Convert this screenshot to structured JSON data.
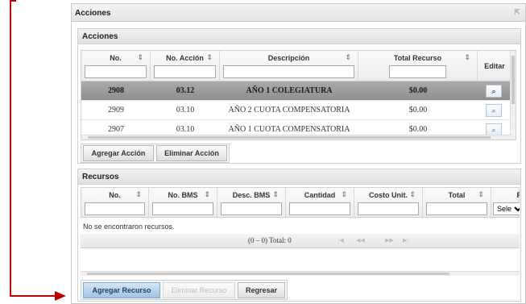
{
  "outer": {
    "title": "Acciones",
    "toggle_glyph": "⇱"
  },
  "acciones": {
    "title": "Acciones",
    "columns": [
      "No.",
      "No. Acción",
      "Descripción",
      "Total Recurso",
      "Editar"
    ],
    "sort_glyph": "⇕",
    "rows": [
      {
        "no": "2908",
        "accion": "03.12",
        "descripcion": "AÑO 1 COLEGIATURA",
        "total": "$0.00",
        "selected": true
      },
      {
        "no": "2909",
        "accion": "03.10",
        "descripcion": "AÑO 2 CUOTA COMPENSATORIA",
        "total": "$0.00",
        "selected": false
      },
      {
        "no": "2907",
        "accion": "03.10",
        "descripcion": "AÑO 1 CUOTA COMPENSATORIA",
        "total": "$0.00",
        "selected": false
      }
    ],
    "edit_icon": "magnifier-icon",
    "edit_glyph": "⌕",
    "buttons": {
      "agregar": "Agregar Acción",
      "eliminar": "Eliminar Acción"
    }
  },
  "recursos": {
    "title": "Recursos",
    "columns": [
      "No.",
      "No. BMS",
      "Desc. BMS",
      "Cantidad",
      "Costo Unit.",
      "Total",
      "R"
    ],
    "select_placeholder": "Selec",
    "empty_message": "No se encontraron recursos.",
    "paginator_text": "(0 – 0) Total: 0",
    "paginator_glyphs": [
      "|◀",
      "◀◀",
      "▶▶",
      "▶|"
    ]
  },
  "footer_buttons": {
    "agregar": "Agregar Recurso",
    "eliminar": "Eliminar Recurso",
    "regresar": "Regresar"
  },
  "colors": {
    "annotation": "#c00000",
    "selected_row": "#9a9a9a",
    "primary_button": "#9ec3e6"
  }
}
